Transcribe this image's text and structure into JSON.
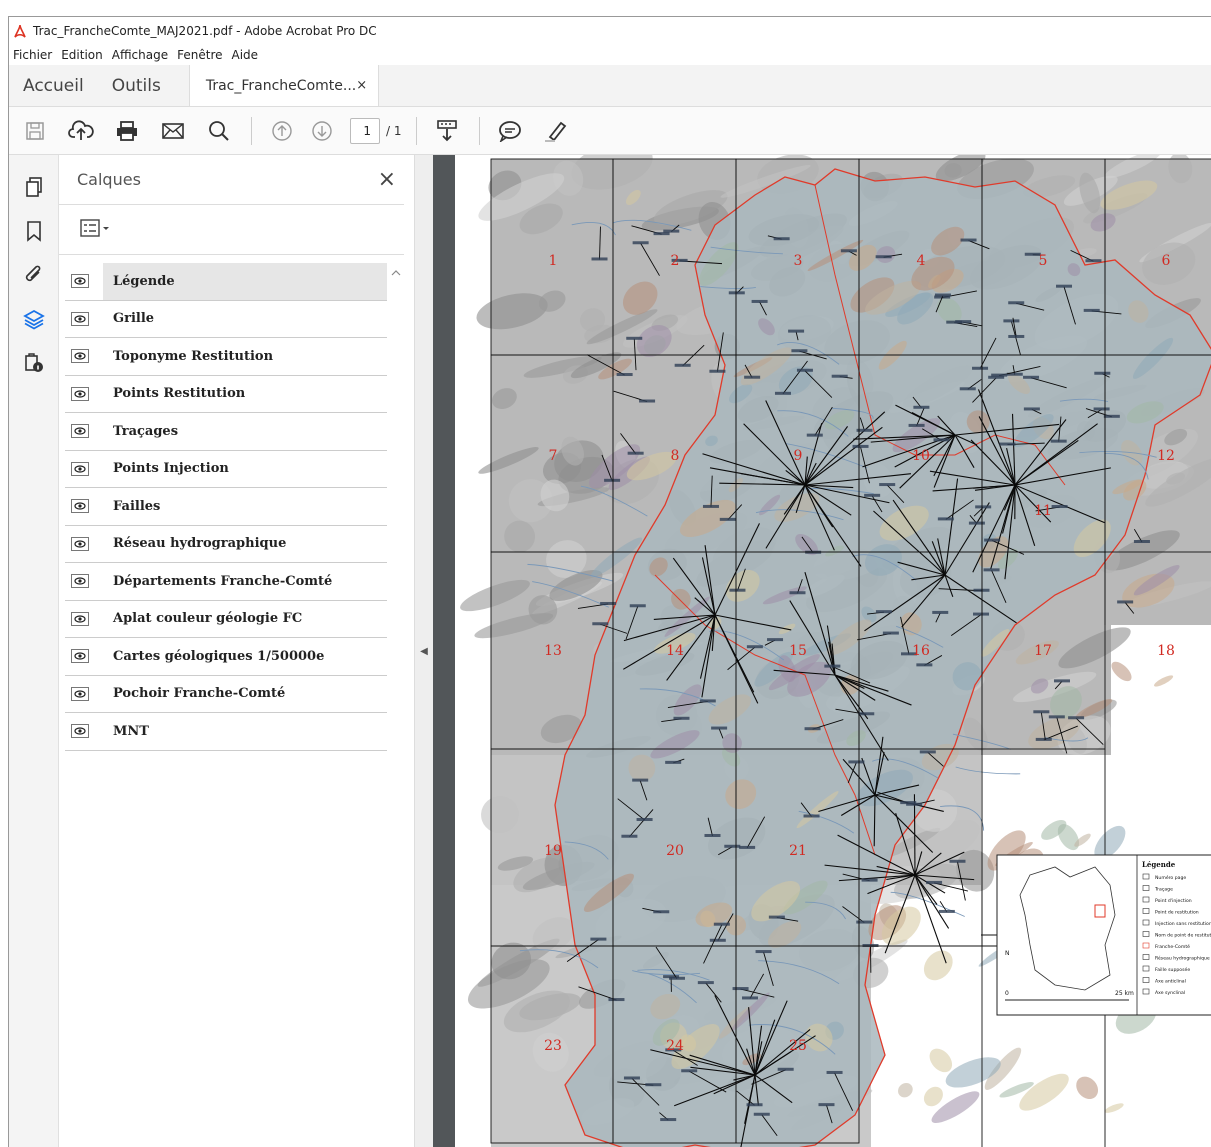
{
  "window": {
    "title": "Trac_FrancheComte_MAJ2021.pdf - Adobe Acrobat Pro DC"
  },
  "menubar": {
    "items": [
      "Fichier",
      "Edition",
      "Affichage",
      "Fenêtre",
      "Aide"
    ]
  },
  "tabs": {
    "home": "Accueil",
    "tools": "Outils",
    "document": "Trac_FrancheComte...",
    "close": "×"
  },
  "toolbar": {
    "icons": [
      "save-icon",
      "upload-icon",
      "print-icon",
      "email-icon",
      "search-icon",
      "page-up-icon",
      "page-down-icon",
      "download-icon",
      "comment-icon",
      "highlight-pen-icon"
    ],
    "page_current": "1",
    "page_total": "/ 1"
  },
  "leftrail": {
    "icons": [
      "pages-icon",
      "bookmark-icon",
      "attachment-icon",
      "layers-icon",
      "security-lock-icon"
    ]
  },
  "panel": {
    "title": "Calques",
    "close": "×",
    "layers": [
      {
        "name": "Légende",
        "visible": true,
        "selected": true
      },
      {
        "name": "Grille",
        "visible": true
      },
      {
        "name": "Toponyme Restitution",
        "visible": true
      },
      {
        "name": "Points Restitution",
        "visible": true
      },
      {
        "name": "Traçages",
        "visible": true
      },
      {
        "name": "Points Injection",
        "visible": true
      },
      {
        "name": "Failles",
        "visible": true
      },
      {
        "name": "Réseau hydrographique",
        "visible": true
      },
      {
        "name": "Départements Franche-Comté",
        "visible": true
      },
      {
        "name": "Aplat couleur géologie FC",
        "visible": true
      },
      {
        "name": "Cartes géologiques 1/50000e",
        "visible": true
      },
      {
        "name": "Pochoir Franche-Comté",
        "visible": true
      },
      {
        "name": "MNT",
        "visible": true
      }
    ]
  },
  "map": {
    "grid_numbers": [
      "1",
      "2",
      "3",
      "4",
      "5",
      "6",
      "7",
      "8",
      "9",
      "10",
      "11",
      "12",
      "13",
      "14",
      "15",
      "16",
      "17",
      "18",
      "19",
      "20",
      "21",
      "23",
      "24",
      "25"
    ],
    "legend": {
      "title": "Légende",
      "items": [
        "Numéro page",
        "Traçage",
        "Point d'injection",
        "Point de restitution",
        "Injection sans restitution",
        "Nom de point de restitution",
        "Franche-Comté",
        "Réseau hydrographique",
        "Faille supposée",
        "Axe anticlinal",
        "Axe synclinal"
      ],
      "scale_start": "0",
      "scale_end": "25 km",
      "north": "N"
    },
    "colors": {
      "boundary": "#e03a2a",
      "grid": "#111111",
      "tracings": "#0a0a0a",
      "number": "#d12a22"
    }
  }
}
